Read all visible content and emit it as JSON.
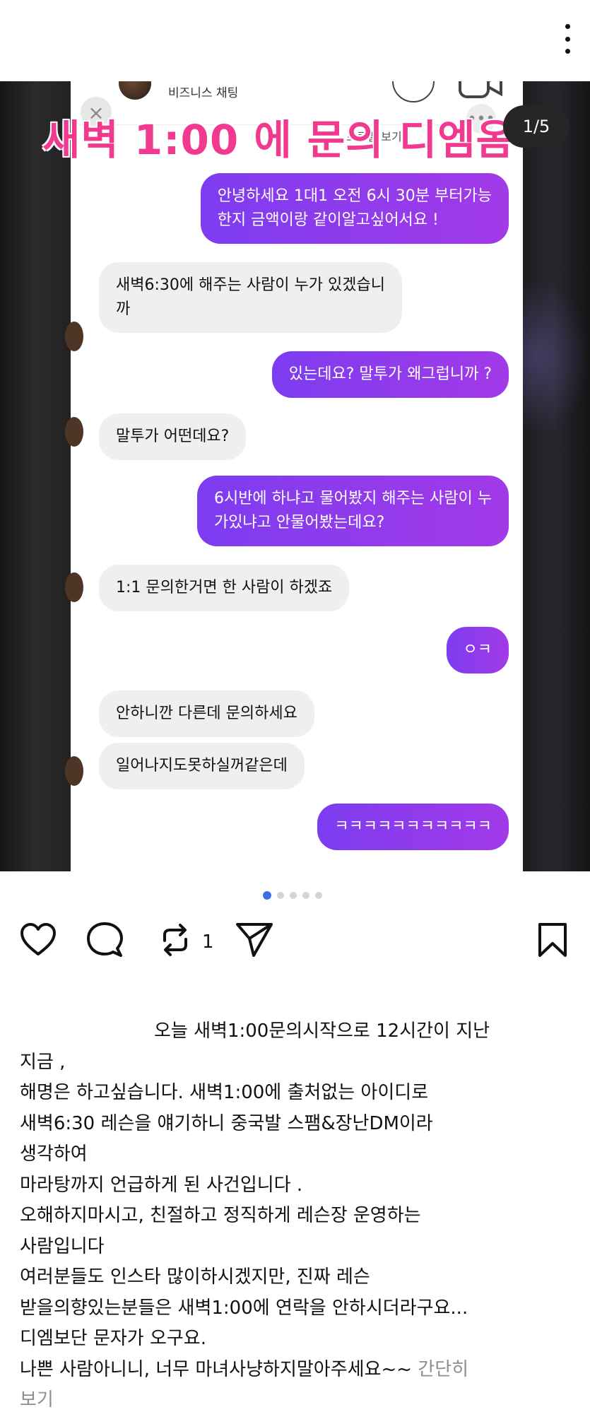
{
  "header": {
    "more_icon": "more-vertical-icon"
  },
  "post_image": {
    "overlay_title": "새벽 1:00 에 문의 디엠옴",
    "page_counter": "1/5",
    "chat_header_title": "비즈니스 채팅",
    "chat_header_sub": "프로필 보기",
    "close_glyph": "×",
    "dots_glyph": "•••",
    "messages": [
      {
        "side": "out",
        "lines": [
          "안녕하세요 1대1 오전 6시 30분 부터가능",
          "한지 금액이랑 같이알고싶어서요 !"
        ]
      },
      {
        "side": "in",
        "lines": [
          "새벽6:30에 해주는 사람이 누가 있겠습니",
          "까"
        ]
      },
      {
        "side": "out",
        "lines": [
          "있는데요? 말투가 왜그럽니까 ?"
        ]
      },
      {
        "side": "in",
        "lines": [
          "말투가 어떤데요?"
        ]
      },
      {
        "side": "out",
        "lines": [
          "6시반에 하냐고 물어봤지 해주는 사람이 누",
          "가있냐고 안물어봤는데요?"
        ]
      },
      {
        "side": "in",
        "lines": [
          "1:1 문의한거면 한 사람이 하겠죠"
        ]
      },
      {
        "side": "out",
        "lines": [
          "ㅇㅋ"
        ]
      },
      {
        "side": "in",
        "lines": [
          "안하니깐 다른데 문의하세요"
        ]
      },
      {
        "side": "in",
        "lines": [
          "일어나지도못하실꺼같은데"
        ]
      },
      {
        "side": "out",
        "lines": [
          "ㅋㅋㅋㅋㅋㅋㅋㅋㅋㅋㅋ"
        ]
      }
    ]
  },
  "carousel": {
    "count": 5,
    "active_index": 0
  },
  "actions": {
    "like_icon": "heart-icon",
    "comment_icon": "comment-icon",
    "repost_icon": "repost-icon",
    "repost_count": "1",
    "share_icon": "send-icon",
    "save_icon": "bookmark-icon"
  },
  "caption": {
    "lines": [
      "오늘 새벽1:00문의시작으로 12시간이 지난",
      "지금 ,",
      "해명은 하고싶습니다.  새벽1:00에 출처없는 아이디로",
      "새벽6:30 레슨을 얘기하니 중국발 스팸&장난DM이라",
      "생각하여",
      "마라탕까지 언급하게 된 사건입니다 .",
      "오해하지마시고, 친절하고 정직하게 레슨장 운영하는",
      "사람입니다",
      "여러분들도 인스타 많이하시겠지만, 진짜 레슨",
      "받을의향있는분들은 새벽1:00에 연락을 안하시더라구요...",
      "디엠보단 문자가 오구요.",
      "나쁜 사람아니니, 너무 마녀사냥하지말아주세요~~ "
    ],
    "more_link_first": "간단히",
    "more_link_second": "보기"
  },
  "colors": {
    "accent_purple": "#8a3cf0",
    "overlay_pink": "#f0398f",
    "carousel_active": "#3b6fe0"
  }
}
